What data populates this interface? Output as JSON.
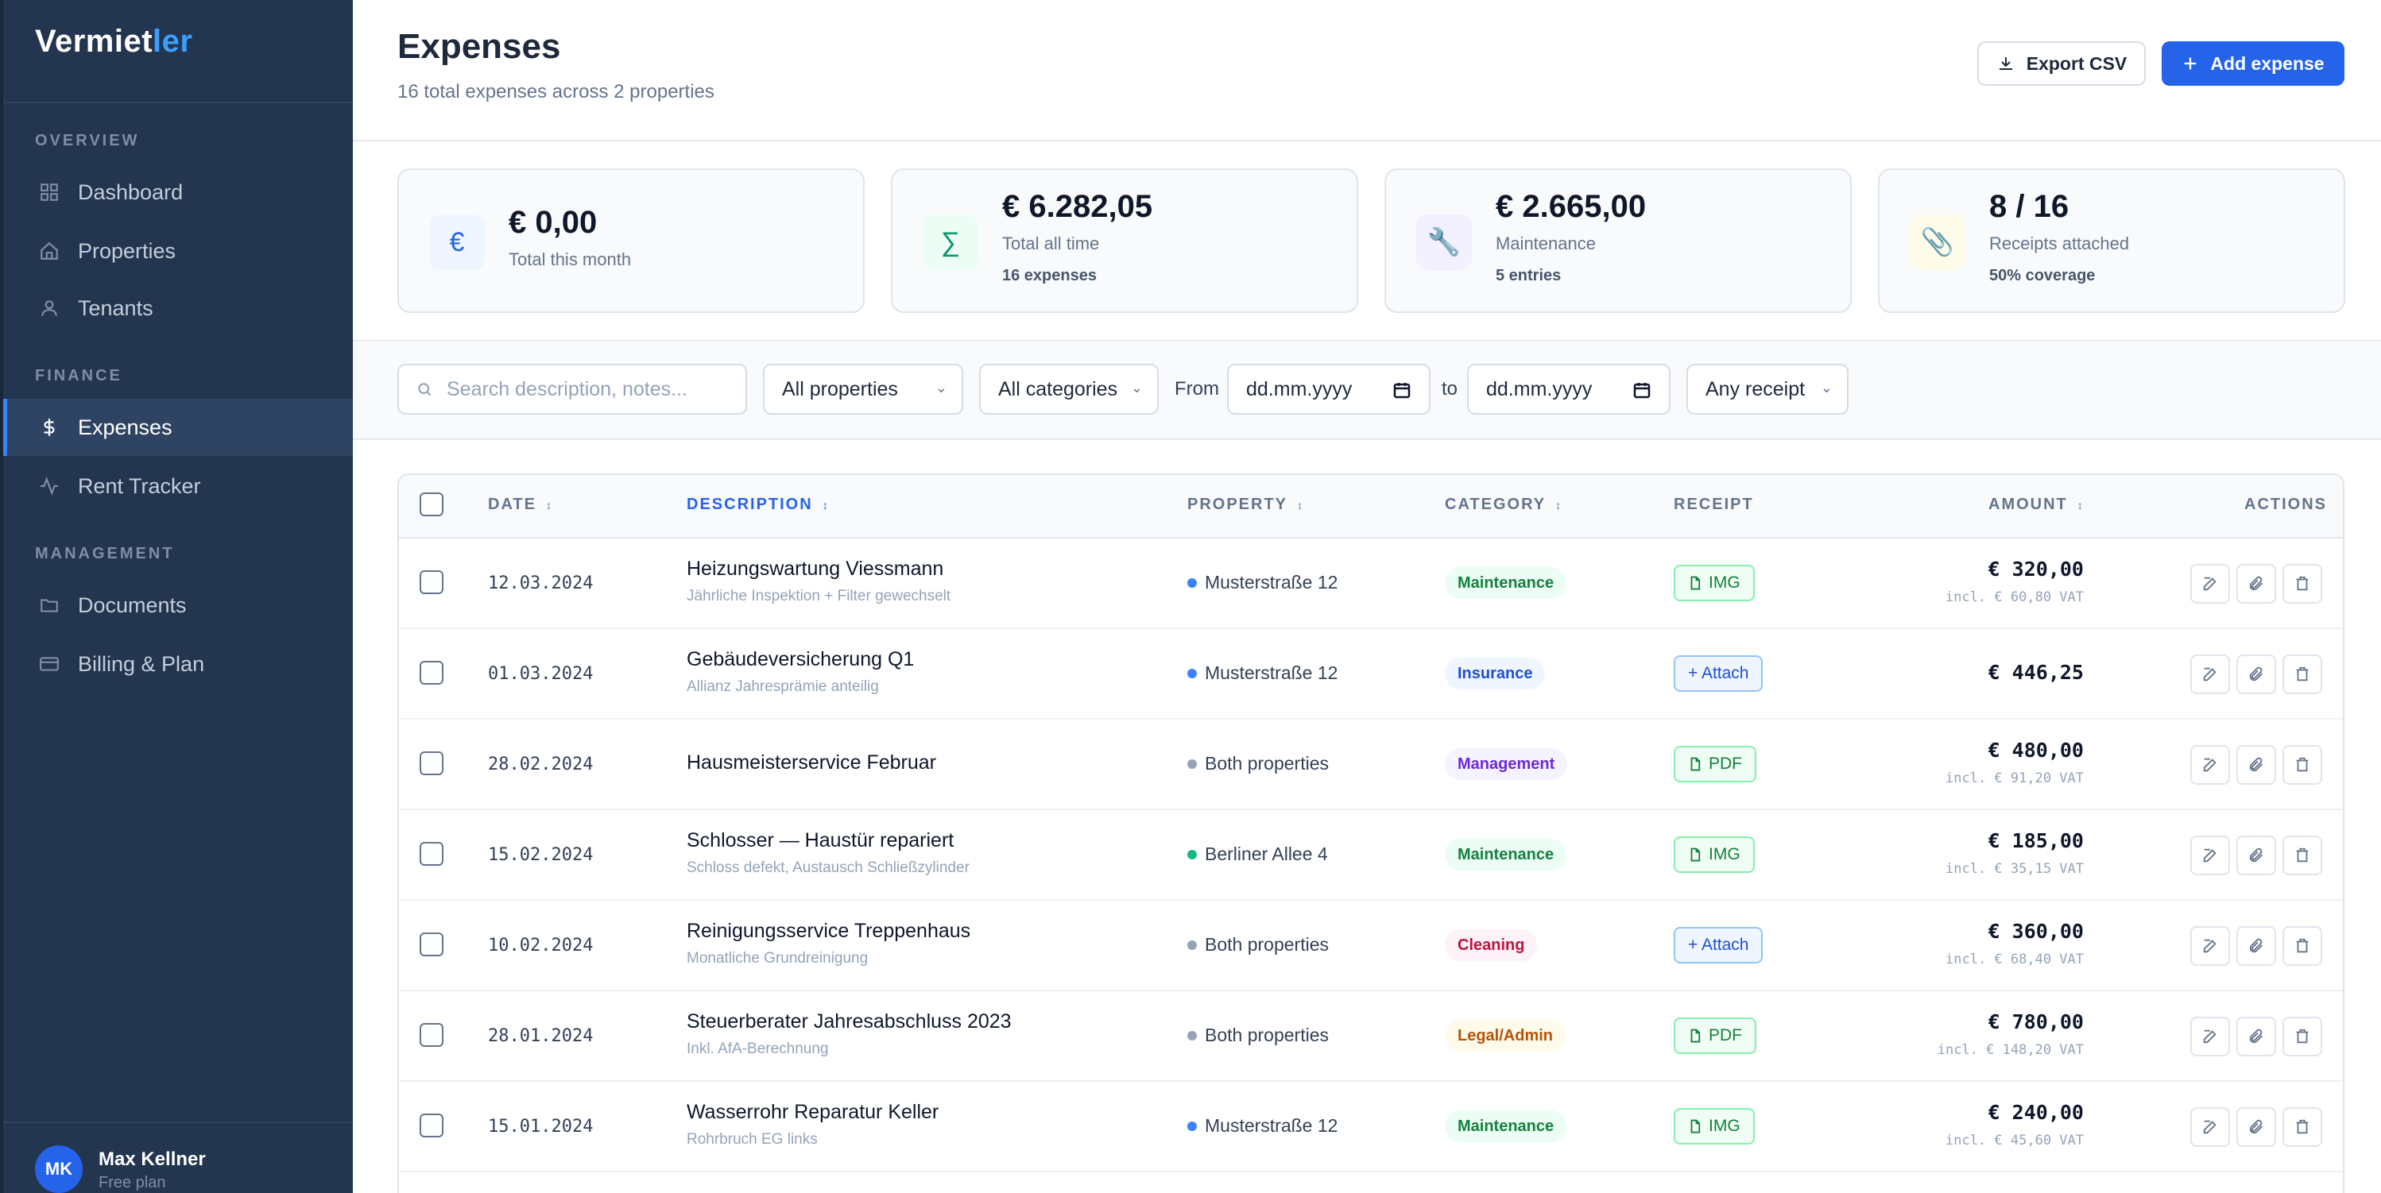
{
  "brand": {
    "part1": "Vermiet",
    "part2": "ler"
  },
  "sidebar": {
    "sections": [
      {
        "label": "OVERVIEW"
      },
      {
        "label": "FINANCE"
      },
      {
        "label": "MANAGEMENT"
      }
    ],
    "items": [
      {
        "label": "Dashboard",
        "icon": "grid-icon"
      },
      {
        "label": "Properties",
        "icon": "home-icon"
      },
      {
        "label": "Tenants",
        "icon": "user-icon"
      },
      {
        "label": "Expenses",
        "icon": "dollar-icon",
        "active": true
      },
      {
        "label": "Rent Tracker",
        "icon": "activity-icon"
      },
      {
        "label": "Documents",
        "icon": "folder-icon"
      },
      {
        "label": "Billing & Plan",
        "icon": "credit-card-icon"
      }
    ],
    "user": {
      "initials": "MK",
      "name": "Max Kellner",
      "plan": "Free plan"
    }
  },
  "header": {
    "title": "Expenses",
    "subtitle": "16 total expenses across 2 properties",
    "export_label": "Export CSV",
    "add_label": "Add expense"
  },
  "stats": [
    {
      "value": "€ 0,00",
      "label": "Total this month",
      "sub": "",
      "icon": "€",
      "icon_name": "euro-icon",
      "icon_bg": "#eff6ff",
      "icon_color": "#2563eb"
    },
    {
      "value": "€ 6.282,05",
      "label": "Total all time",
      "sub": "16 expenses",
      "icon": "∑",
      "icon_name": "sigma-icon",
      "icon_bg": "#ecfdf5",
      "icon_color": "#059669"
    },
    {
      "value": "€ 2.665,00",
      "label": "Maintenance",
      "sub": "5 entries",
      "icon": "🔧",
      "icon_name": "wrench-icon",
      "icon_bg": "#f3f0ff",
      "icon_color": "#64748b"
    },
    {
      "value": "8 / 16",
      "label": "Receipts attached",
      "sub": "50% coverage",
      "icon": "📎",
      "icon_name": "paperclip-icon",
      "icon_bg": "#fefce8",
      "icon_color": "#64748b"
    }
  ],
  "filters": {
    "search_placeholder": "Search description, notes...",
    "property": "All properties",
    "category": "All categories",
    "from_label": "From",
    "to_label": "to",
    "from_value": "dd.mm.yyyy",
    "to_value": "dd.mm.yyyy",
    "receipt": "Any receipt"
  },
  "table": {
    "headers": {
      "date": "DATE",
      "description": "DESCRIPTION",
      "property": "PROPERTY",
      "category": "CATEGORY",
      "receipt": "RECEIPT",
      "amount": "AMOUNT",
      "actions": "ACTIONS"
    },
    "sort_icon": "↕",
    "rows": [
      {
        "date": "12.03.2024",
        "title": "Heizungswartung Viessmann",
        "note": "Jährliche Inspektion + Filter gewechselt",
        "property": "Musterstraße 12",
        "dot": "#3b82f6",
        "category": "Maintenance",
        "cat_bg": "#ecfdf5",
        "cat_color": "#15803d",
        "receipt": "IMG",
        "receipt_type": "file",
        "amount": "€ 320,00",
        "vat": "incl. € 60,80 VAT"
      },
      {
        "date": "01.03.2024",
        "title": "Gebäudeversicherung Q1",
        "note": "Allianz Jahresprämie anteilig",
        "property": "Musterstraße 12",
        "dot": "#3b82f6",
        "category": "Insurance",
        "cat_bg": "#eff6ff",
        "cat_color": "#1d4ed8",
        "receipt": "+ Attach",
        "receipt_type": "attach",
        "amount": "€ 446,25",
        "vat": ""
      },
      {
        "date": "28.02.2024",
        "title": "Hausmeisterservice Februar",
        "note": "",
        "property": "Both properties",
        "dot": "#94a3b8",
        "category": "Management",
        "cat_bg": "#f5f3ff",
        "cat_color": "#6d28d9",
        "receipt": "PDF",
        "receipt_type": "file",
        "amount": "€ 480,00",
        "vat": "incl. € 91,20 VAT"
      },
      {
        "date": "15.02.2024",
        "title": "Schlosser — Haustür repariert",
        "note": "Schloss defekt, Austausch Schließzylinder",
        "property": "Berliner Allee 4",
        "dot": "#10b981",
        "category": "Maintenance",
        "cat_bg": "#ecfdf5",
        "cat_color": "#15803d",
        "receipt": "IMG",
        "receipt_type": "file",
        "amount": "€ 185,00",
        "vat": "incl. € 35,15 VAT"
      },
      {
        "date": "10.02.2024",
        "title": "Reinigungsservice Treppenhaus",
        "note": "Monatliche Grundreinigung",
        "property": "Both properties",
        "dot": "#94a3b8",
        "category": "Cleaning",
        "cat_bg": "#fdf2f8",
        "cat_color": "#be123c",
        "receipt": "+ Attach",
        "receipt_type": "attach",
        "amount": "€ 360,00",
        "vat": "incl. € 68,40 VAT"
      },
      {
        "date": "28.01.2024",
        "title": "Steuerberater Jahresabschluss 2023",
        "note": "Inkl. AfA-Berechnung",
        "property": "Both properties",
        "dot": "#94a3b8",
        "category": "Legal/Admin",
        "cat_bg": "#fffbeb",
        "cat_color": "#b45309",
        "receipt": "PDF",
        "receipt_type": "file",
        "amount": "€ 780,00",
        "vat": "incl. € 148,20 VAT"
      },
      {
        "date": "15.01.2024",
        "title": "Wasserrohr Reparatur Keller",
        "note": "Rohrbruch EG links",
        "property": "Musterstraße 12",
        "dot": "#3b82f6",
        "category": "Maintenance",
        "cat_bg": "#ecfdf5",
        "cat_color": "#15803d",
        "receipt": "IMG",
        "receipt_type": "file",
        "amount": "€ 240,00",
        "vat": "incl. € 45,60 VAT"
      }
    ]
  }
}
